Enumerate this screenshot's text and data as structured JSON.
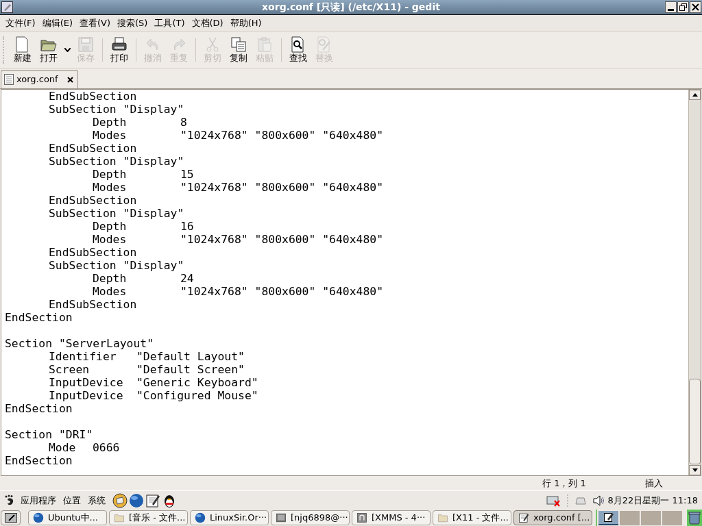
{
  "window": {
    "title": "xorg.conf [只读] (/etc/X11) - gedit"
  },
  "menu": [
    {
      "label": "文件(F)"
    },
    {
      "label": "编辑(E)"
    },
    {
      "label": "查看(V)"
    },
    {
      "label": "搜索(S)"
    },
    {
      "label": "工具(T)"
    },
    {
      "label": "文档(D)"
    },
    {
      "label": "帮助(H)"
    }
  ],
  "toolbar": [
    {
      "kind": "new",
      "label": "新建",
      "disabled": false
    },
    {
      "kind": "open",
      "label": "打开",
      "disabled": false
    },
    {
      "kind": "dropdown"
    },
    {
      "kind": "save",
      "label": "保存",
      "disabled": true
    },
    {
      "kind": "sep"
    },
    {
      "kind": "print",
      "label": "打印",
      "disabled": false
    },
    {
      "kind": "sep"
    },
    {
      "kind": "undo",
      "label": "撤消",
      "disabled": true
    },
    {
      "kind": "redo",
      "label": "重复",
      "disabled": true
    },
    {
      "kind": "sep"
    },
    {
      "kind": "cut",
      "label": "剪切",
      "disabled": true
    },
    {
      "kind": "copy",
      "label": "复制",
      "disabled": false
    },
    {
      "kind": "paste",
      "label": "粘贴",
      "disabled": true
    },
    {
      "kind": "sep"
    },
    {
      "kind": "find",
      "label": "查找",
      "disabled": false
    },
    {
      "kind": "replace",
      "label": "替换",
      "disabled": true
    }
  ],
  "tabs": [
    {
      "label": "xorg.conf",
      "selected": true
    }
  ],
  "editor": {
    "blocks": [
      {
        "lines": [
          "\tEndSubSection",
          "\tSubSection \"Display\"",
          "\t\tDepth\t\t8",
          "\t\tModes\t\t\"1024x768\" \"800x600\" \"640x480\"",
          "\tEndSubSection",
          "\tSubSection \"Display\"",
          "\t\tDepth\t\t15",
          "\t\tModes\t\t\"1024x768\" \"800x600\" \"640x480\"",
          "\tEndSubSection",
          "\tSubSection \"Display\"",
          "\t\tDepth\t\t16",
          "\t\tModes\t\t\"1024x768\" \"800x600\" \"640x480\"",
          "\tEndSubSection",
          "\tSubSection \"Display\"",
          "\t\tDepth\t\t24",
          "\t\tModes\t\t\"1024x768\" \"800x600\" \"640x480\"",
          "\tEndSubSection",
          "EndSection"
        ]
      },
      {
        "lines": [
          "Section \"ServerLayout\"",
          "\tIdentifier\t\"Default Layout\"",
          "\tScreen\t\"Default Screen\"",
          "\tInputDevice\t\"Generic Keyboard\"",
          "\tInputDevice\t\"Configured Mouse\"",
          "EndSection"
        ]
      },
      {
        "lines": [
          "Section \"DRI\"",
          "\tMode\t0666",
          "EndSection"
        ]
      }
    ]
  },
  "status_bar": {
    "position": "行 1，列 1",
    "mode": "插入"
  },
  "top_panel": {
    "menus": [
      "应用程序",
      "位置",
      "系统"
    ],
    "launchers": [
      {
        "kind": "sticker"
      },
      {
        "kind": "globe"
      },
      {
        "kind": "notepad"
      },
      {
        "kind": "penguin"
      }
    ],
    "clock": "8月22日星期一 11:18"
  },
  "taskbar": [
    {
      "kind": "globe",
      "label": "Ubuntu中...",
      "selected": false
    },
    {
      "kind": "folder",
      "label": "[音乐 - 文件...",
      "selected": false
    },
    {
      "kind": "globe",
      "label": "LinuxSir.Or···",
      "selected": false
    },
    {
      "kind": "terminal",
      "label": "[njq6898@···",
      "selected": false
    },
    {
      "kind": "xmms",
      "label": "[XMMS - 4···",
      "selected": false
    },
    {
      "kind": "folder",
      "label": "[X11 - 文件...",
      "selected": false
    },
    {
      "kind": "notepad",
      "label": "xorg.conf [...",
      "selected": true
    }
  ],
  "workspaces": [
    {
      "selected": true
    },
    {
      "selected": false
    },
    {
      "selected": false
    },
    {
      "selected": false
    }
  ]
}
